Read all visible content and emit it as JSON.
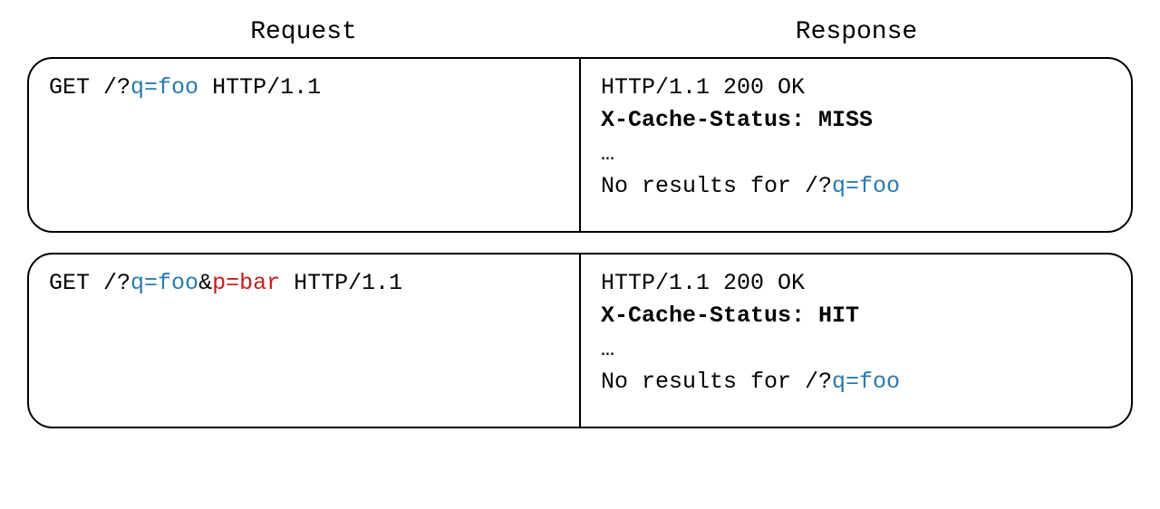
{
  "headers": {
    "request": "Request",
    "response": "Response"
  },
  "colors": {
    "blue": "#2a7aaf",
    "red": "#c22020"
  },
  "rows": [
    {
      "request": {
        "method": "GET",
        "path_prefix": "/?",
        "query_primary": "q=foo",
        "query_separator": "",
        "query_secondary": "",
        "suffix": " HTTP/1.1"
      },
      "response": {
        "status_line": "HTTP/1.1 200 OK",
        "cache_header_label": "X-Cache-Status: ",
        "cache_header_value": "MISS",
        "ellipsis": "…",
        "body_prefix": "No results for /?",
        "body_query": "q=foo"
      }
    },
    {
      "request": {
        "method": "GET",
        "path_prefix": "/?",
        "query_primary": "q=foo",
        "query_separator": "&",
        "query_secondary": "p=bar",
        "suffix": " HTTP/1.1"
      },
      "response": {
        "status_line": "HTTP/1.1 200 OK",
        "cache_header_label": "X-Cache-Status: ",
        "cache_header_value": "HIT",
        "ellipsis": "…",
        "body_prefix": "No results for /?",
        "body_query": "q=foo"
      }
    }
  ]
}
